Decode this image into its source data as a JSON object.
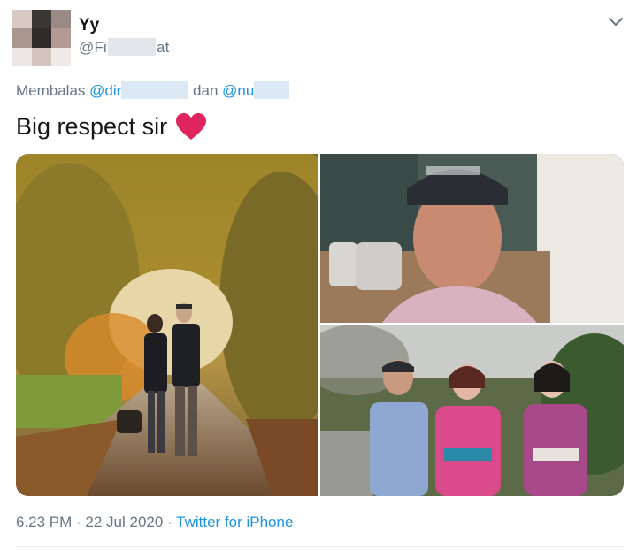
{
  "author": {
    "name": "Yy",
    "handle_start": "@Fi",
    "handle_end": "at"
  },
  "reply": {
    "prefix": "Membalas",
    "mention1_start": "@dir",
    "connector": "dan",
    "mention2_start": "@nu"
  },
  "tweet": {
    "text": "Big respect sir",
    "emoji": "heart-icon"
  },
  "media": {
    "photos": [
      "photo-couple-autumn-path",
      "photo-man-selfie-cap",
      "photo-man-with-two-women-kimono"
    ]
  },
  "meta": {
    "time": "6.23 PM",
    "separator1": " · ",
    "date": "22 Jul 2020",
    "separator2": " · ",
    "source": "Twitter for iPhone"
  },
  "icons": {
    "caret": "chevron-down-icon"
  },
  "colors": {
    "link": "#1b95e0",
    "secondary_text": "#657786",
    "heart": "#e0245e"
  }
}
